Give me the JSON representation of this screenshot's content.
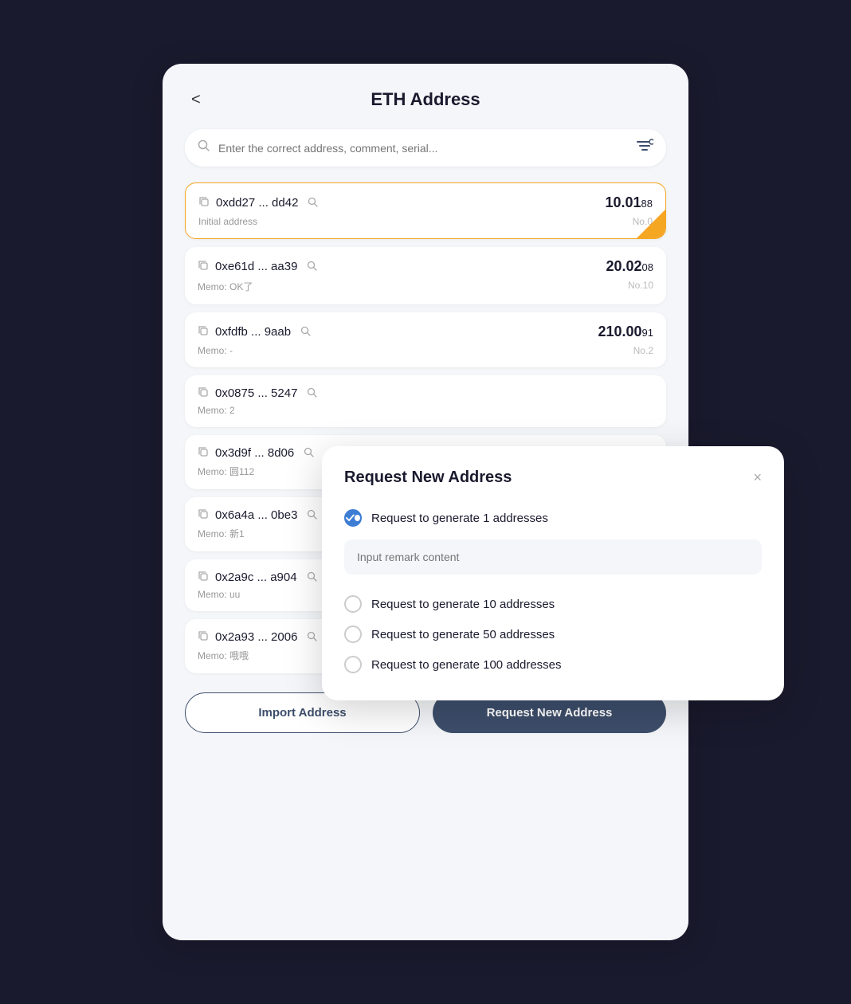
{
  "page": {
    "title": "ETH Address",
    "back_label": "<"
  },
  "search": {
    "placeholder": "Enter the correct address, comment, serial..."
  },
  "addresses": [
    {
      "address": "0xdd27 ... dd42",
      "memo": "Initial address",
      "amount_main": "10.01",
      "amount_sub": "88",
      "no": "No.0",
      "active": true
    },
    {
      "address": "0xe61d ... aa39",
      "memo": "Memo: OK了",
      "amount_main": "20.02",
      "amount_sub": "08",
      "no": "No.10",
      "active": false
    },
    {
      "address": "0xfdfb ... 9aab",
      "memo": "Memo: -",
      "amount_main": "210.00",
      "amount_sub": "91",
      "no": "No.2",
      "active": false
    },
    {
      "address": "0x0875 ... 5247",
      "memo": "Memo: 2",
      "amount_main": "",
      "amount_sub": "",
      "no": "",
      "active": false
    },
    {
      "address": "0x3d9f ... 8d06",
      "memo": "Memo: 圆112",
      "amount_main": "",
      "amount_sub": "",
      "no": "",
      "active": false
    },
    {
      "address": "0x6a4a ... 0be3",
      "memo": "Memo: 新1",
      "amount_main": "",
      "amount_sub": "",
      "no": "",
      "active": false
    },
    {
      "address": "0x2a9c ... a904",
      "memo": "Memo: uu",
      "amount_main": "",
      "amount_sub": "",
      "no": "",
      "active": false
    },
    {
      "address": "0x2a93 ... 2006",
      "memo": "Memo: 哦哦",
      "amount_main": "",
      "amount_sub": "",
      "no": "",
      "active": false
    }
  ],
  "footer": {
    "import_label": "Import Address",
    "request_label": "Request New Address"
  },
  "modal": {
    "title": "Request New Address",
    "close_label": "×",
    "remark_placeholder": "Input remark content",
    "options": [
      {
        "label": "Request to generate 1 addresses",
        "checked": true
      },
      {
        "label": "Request to generate 10 addresses",
        "checked": false
      },
      {
        "label": "Request to generate 50 addresses",
        "checked": false
      },
      {
        "label": "Request to generate 100 addresses",
        "checked": false
      }
    ]
  }
}
